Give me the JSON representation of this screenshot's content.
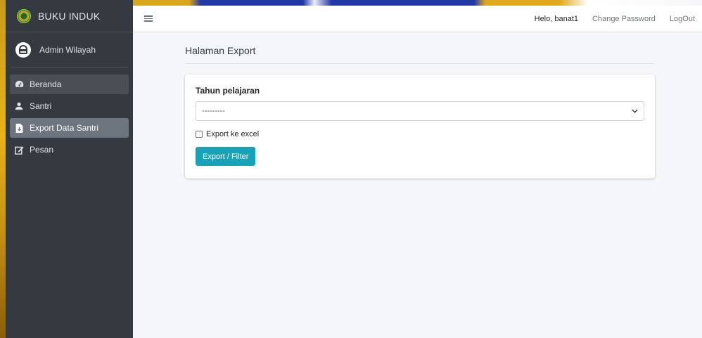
{
  "brand": {
    "title": "BUKU INDUK"
  },
  "user": {
    "name": "Admin Wilayah"
  },
  "sidebar": {
    "items": [
      {
        "label": "Beranda",
        "icon": "dashboard-icon"
      },
      {
        "label": "Santri",
        "icon": "user-icon"
      },
      {
        "label": "Export Data Santri",
        "icon": "file-export-icon"
      },
      {
        "label": "Pesan",
        "icon": "edit-icon"
      }
    ],
    "active_index": 2
  },
  "navbar": {
    "greeting": "Helo, banat1",
    "change_password": "Change Password",
    "logout": "LogOut"
  },
  "page": {
    "title": "Halaman Export"
  },
  "form": {
    "tahun_label": "Tahun pelajaran",
    "tahun_value": "---------",
    "excel_label": "Export ke excel",
    "excel_checked": false,
    "submit_label": "Export / Filter"
  },
  "colors": {
    "sidebar": "#343a40",
    "active_item": "#6c757d",
    "button": "#17a2b8",
    "content_bg": "#f4f6f9"
  }
}
